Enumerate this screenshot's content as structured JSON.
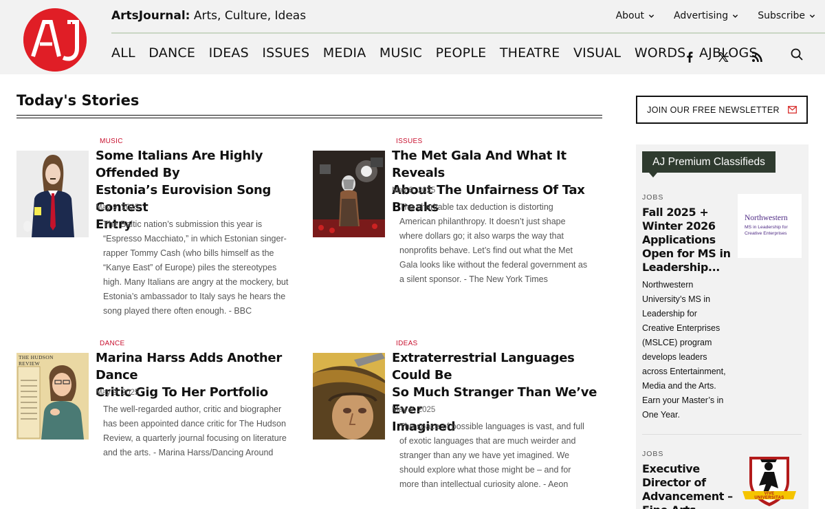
{
  "header": {
    "logo_text": "AJ",
    "brand_name": "ArtsJournal:",
    "tagline": "Arts, Culture, Ideas",
    "topnav": [
      {
        "label": "About"
      },
      {
        "label": "Advertising"
      },
      {
        "label": "Subscribe"
      }
    ],
    "mainnav": [
      "ALL",
      "DANCE",
      "IDEAS",
      "ISSUES",
      "MEDIA",
      "MUSIC",
      "PEOPLE",
      "THEATRE",
      "VISUAL",
      "WORDS",
      "AJBLOGS"
    ],
    "social_icons": [
      "facebook-icon",
      "x-icon",
      "rss-icon",
      "search-icon"
    ]
  },
  "section_title": "Today's Stories",
  "stories": [
    {
      "category": "MUSIC",
      "headline_lines": [
        "Some Italians Are Highly Offended By",
        "Estonia’s Eurovision Song Contest",
        "Entry"
      ],
      "date": "May 9, 2025",
      "excerpt_lines": [
        "The Baltic nation’s submission this year is",
        "“Espresso Macchiato,” in which Estonian singer-",
        "rapper Tommy Cash (who bills himself as the",
        "“Kanye East” of Europe) piles the stereotypes",
        "high. Many Italians are angry at the mockery, but",
        "Estonia’s ambassador to Italy says he hears the",
        "song played there often enough. - BBC"
      ]
    },
    {
      "category": "ISSUES",
      "headline_lines": [
        "The Met Gala And What It Reveals",
        "About The Unfairness Of Tax Breaks"
      ],
      "date": "May 9, 2025",
      "excerpt_lines": [
        "The charitable tax deduction is distorting",
        "American philanthropy. It doesn’t just shape",
        "where dollars go; it also warps the way that",
        "nonprofits behave. Let’s find out what the Met",
        "Gala looks like without the federal government as",
        "a silent sponsor. - The New York Times"
      ]
    },
    {
      "category": "DANCE",
      "headline_lines": [
        "Marina Harss Adds Another Dance",
        "Critic Gig To Her Portfolio"
      ],
      "date": "May 9, 2025",
      "excerpt_lines": [
        "The well-regarded author, critic and biographer",
        "has been appointed dance critic for The Hudson",
        "Review, a quarterly journal focusing on literature",
        "and the arts. - Marina Harss/Dancing Around"
      ],
      "thumb_text": "THE HUDSON REVIEW"
    },
    {
      "category": "IDEAS",
      "headline_lines": [
        "Extraterrestrial Languages Could Be",
        "So Much Stranger Than We’ve Ever",
        "Imagined"
      ],
      "date": "May 9, 2025",
      "excerpt_lines": [
        "The space of possible languages is vast, and full",
        "of exotic languages that are much weirder and",
        "stranger than any we have yet imagined. We",
        "should explore what those might be – and for",
        "more than intellectual curiosity alone. - Aeon"
      ]
    }
  ],
  "sidebar": {
    "newsletter_label": "JOIN OUR FREE NEWSLETTER",
    "classifieds_title": "AJ Premium Classifieds",
    "jobs": [
      {
        "label": "JOBS",
        "title_lines": [
          "Fall 2025 +",
          "Winter 2026",
          "Applications",
          "Open for MS in",
          "Leadership..."
        ],
        "desc_lines": [
          "Northwestern",
          "University’s MS in",
          "Leadership for",
          "Creative Enterprises",
          "(MSLCE) program",
          "develops leaders",
          "across Entertainment,",
          "Media and the Arts.",
          "Earn your Master’s in",
          "One Year."
        ],
        "logo_name": "Northwestern",
        "logo_sub_lines": [
          "MS in Leadership for",
          "Creative Enterprises"
        ]
      },
      {
        "label": "JOBS",
        "title_lines": [
          "Executive",
          "Director of",
          "Advancement –",
          "Fine Arts"
        ],
        "logo_banner": "VIVE UNIVERSITAS"
      }
    ]
  },
  "colors": {
    "brand_red": "#e01e26",
    "category_red": "#c8102e",
    "classifieds_green": "#2f3b2f",
    "header_bg": "#f2f2f2"
  }
}
